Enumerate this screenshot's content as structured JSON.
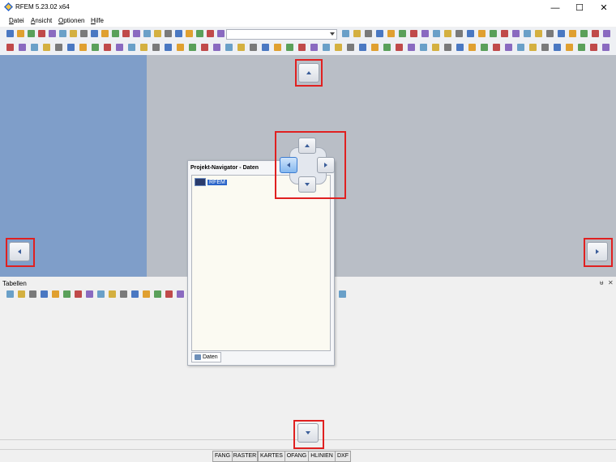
{
  "window": {
    "title": "RFEM 5.23.02 x64",
    "minimize": "—",
    "maximize": "☐",
    "close": "✕"
  },
  "menu": [
    "Datei",
    "Ansicht",
    "Optionen",
    "Hilfe"
  ],
  "tables_panel": {
    "label": "Tabellen",
    "pin": "ᵾ",
    "close": "✕"
  },
  "navigator": {
    "title": "Projekt-Navigator - Daten",
    "root_item": "RFEM",
    "tab_label": "Daten"
  },
  "statusbar": [
    "FANG",
    "RASTER",
    "KARTES",
    "OFANG",
    "HLINIEN",
    "DXF"
  ],
  "colors": {
    "left_panel": "#7f9ec9",
    "workarea": "#b9bec6",
    "highlight_box": "#e02020"
  },
  "icons": {
    "dock_top": "arrow-up-icon",
    "dock_bottom": "arrow-down-icon",
    "dock_left": "arrow-left-icon",
    "dock_right": "arrow-right-icon"
  }
}
